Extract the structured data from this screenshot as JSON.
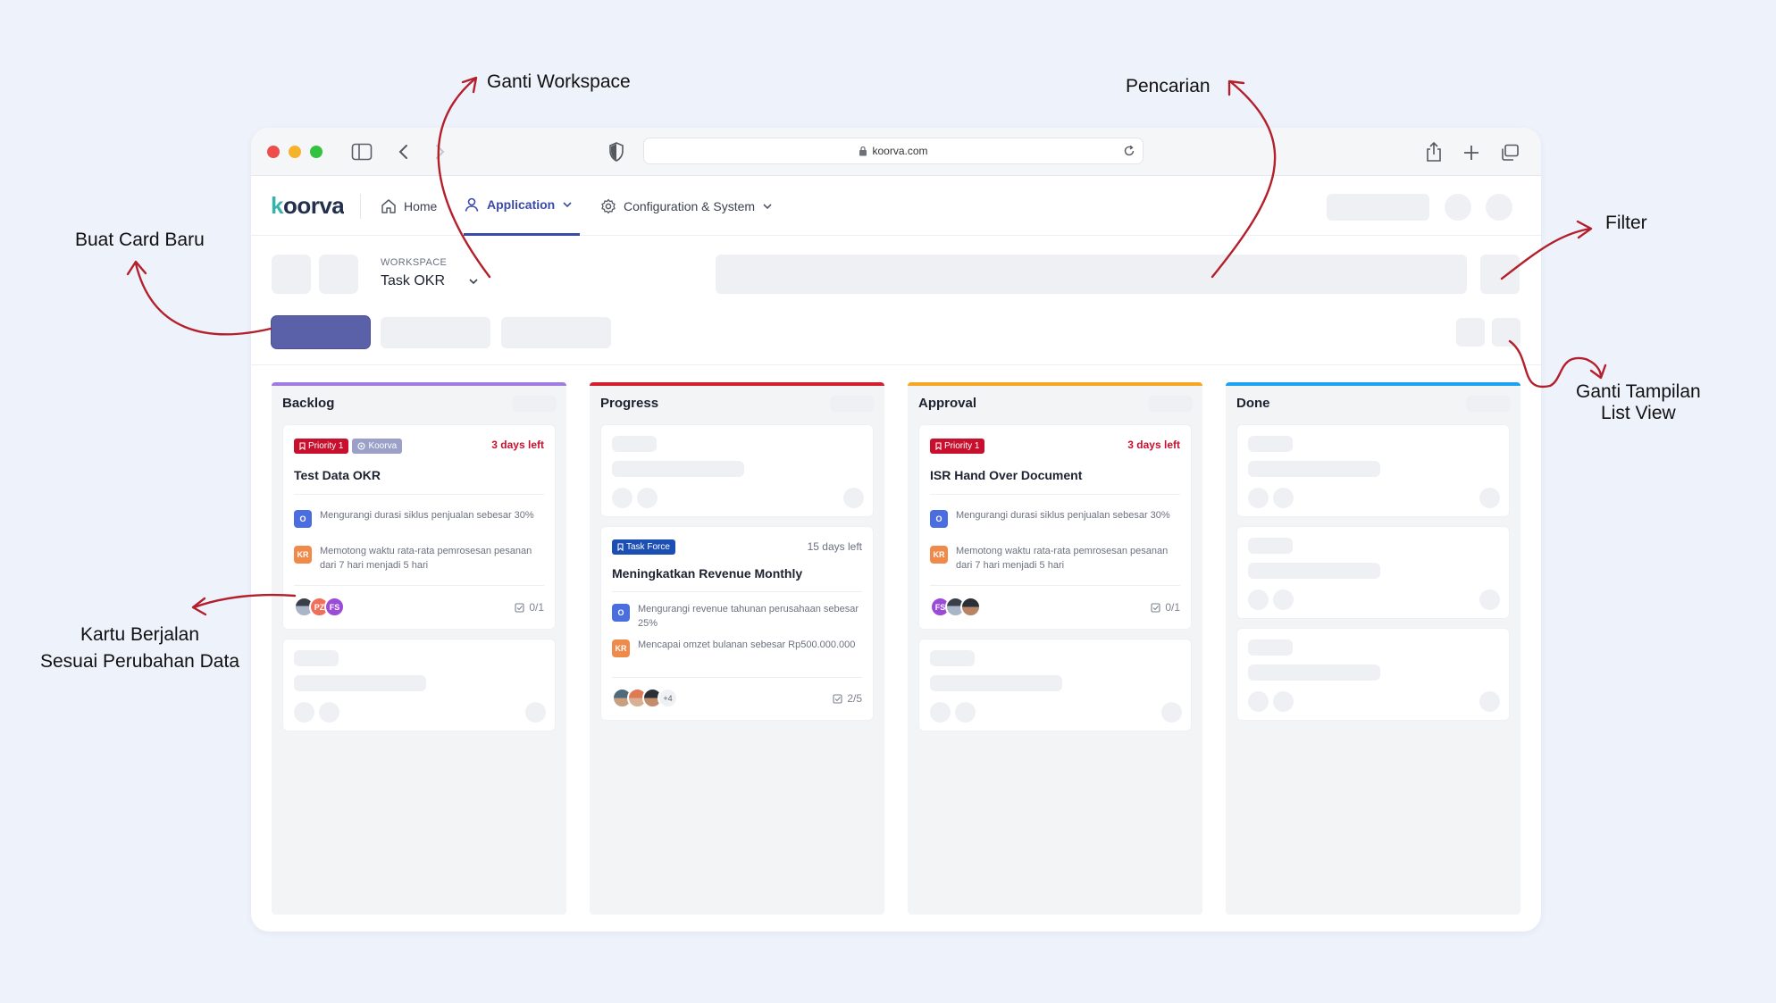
{
  "annotations": {
    "ganti_workspace": "Ganti Workspace",
    "pencarian": "Pencarian",
    "buat_card_baru": "Buat Card Baru",
    "filter": "Filter",
    "ganti_tampilan_1": "Ganti Tampilan",
    "ganti_tampilan_2": "List View",
    "kartu_1": "Kartu Berjalan",
    "kartu_2": "Sesuai Perubahan Data"
  },
  "browser": {
    "url": "koorva.com"
  },
  "colors": {
    "accent": "#3b4aa8",
    "priority": "#c8102e",
    "koorva_tag": "#9aa0c8",
    "task_force": "#1c4fb4",
    "objective": "#4a6ee0",
    "key_result": "#f08a4b"
  },
  "app": {
    "logo": "koorva",
    "nav": {
      "home": "Home",
      "application": "Application",
      "config": "Configuration & System"
    }
  },
  "workspace": {
    "label": "WORKSPACE",
    "name": "Task OKR"
  },
  "columns": [
    {
      "title": "Backlog",
      "color": "#a07be0"
    },
    {
      "title": "Progress",
      "color": "#d3202f"
    },
    {
      "title": "Approval",
      "color": "#f5a623"
    },
    {
      "title": "Done",
      "color": "#1da1f2"
    }
  ],
  "cards": {
    "backlog": {
      "tag_priority": "Priority 1",
      "tag_koorva": "Koorva",
      "deadline": "3 days left",
      "title": "Test Data OKR",
      "o_badge": "O",
      "o_text": "Mengurangi durasi siklus penjualan sebesar 30%",
      "kr_badge": "KR",
      "kr_text": "Memotong waktu rata-rata pemrosesan pesanan dari 7 hari menjadi 5 hari",
      "avatars": [
        "",
        "PZ",
        "FS"
      ],
      "check": "0/1"
    },
    "progress": {
      "tag_taskforce": "Task Force",
      "deadline": "15 days left",
      "title": "Meningkatkan Revenue Monthly",
      "o_badge": "O",
      "o_text": "Mengurangi revenue tahunan perusahaan sebesar 25%",
      "kr_badge": "KR",
      "kr_text": "Mencapai omzet bulanan sebesar Rp500.000.000",
      "more": "+4",
      "check": "2/5"
    },
    "approval": {
      "tag_priority": "Priority 1",
      "deadline": "3 days left",
      "title": "ISR Hand Over Document",
      "o_badge": "O",
      "o_text": "Mengurangi durasi siklus penjualan sebesar 30%",
      "kr_badge": "KR",
      "kr_text": "Memotong waktu rata-rata pemrosesan pesanan dari 7 hari menjadi 5 hari",
      "avatars": [
        "FS",
        "",
        ""
      ],
      "check": "0/1"
    }
  }
}
